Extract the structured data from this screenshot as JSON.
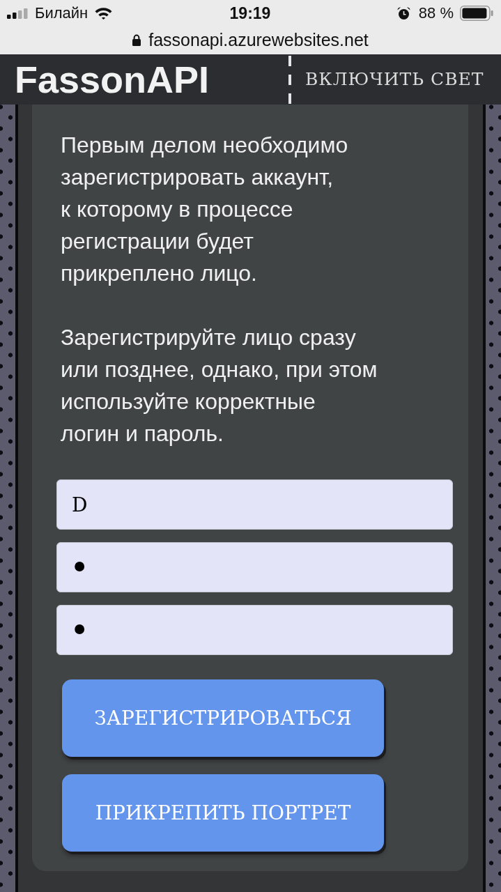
{
  "status_bar": {
    "carrier": "Билайн",
    "time": "19:19",
    "battery": "88 %"
  },
  "address_bar": {
    "url": "fassonapi.azurewebsites.net"
  },
  "header": {
    "logo": "FassonAPI",
    "light_toggle": "ВКЛЮЧИТЬ СВЕТ"
  },
  "intro": [
    "Первым делом необходимо\nзарегистрировать аккаунт,\nк которому в процессе\nрегистрации будет\nприкреплено лицо.",
    "Зарегистрируйте лицо сразу\nили позднее, однако, при этом\nиспользуйте корректные\nлогин и пароль."
  ],
  "fields": [
    {
      "kind": "text",
      "value": "D"
    },
    {
      "kind": "password",
      "value": "•"
    },
    {
      "kind": "password",
      "value": "•"
    }
  ],
  "buttons": [
    "ЗАРЕГИСТРИРОВАТЬСЯ",
    "ПРИКРЕПИТЬ ПОРТРЕТ"
  ]
}
